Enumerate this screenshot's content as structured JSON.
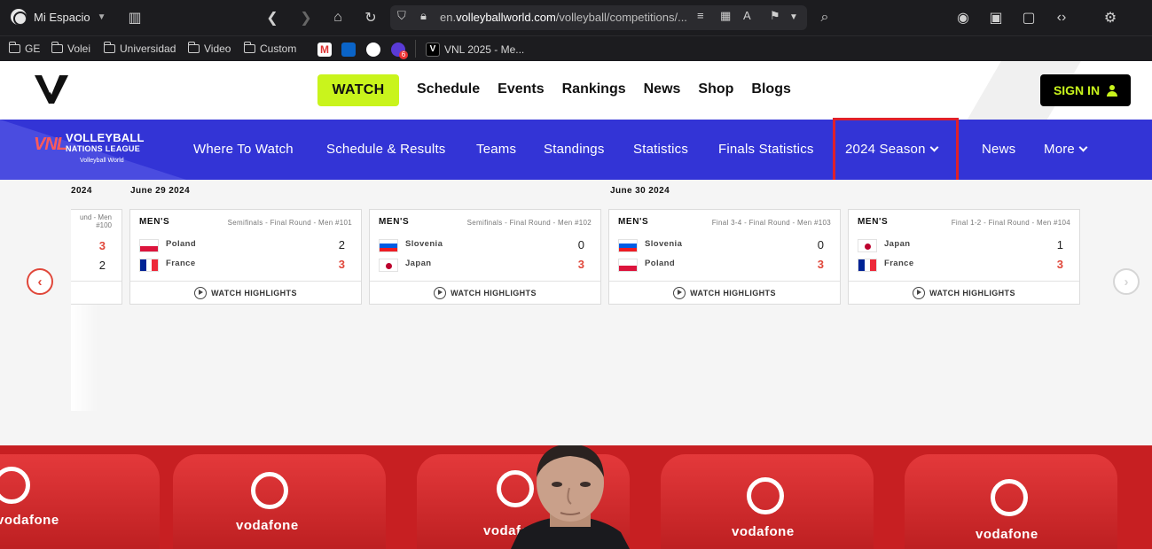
{
  "browser": {
    "profile_name": "Mi Espacio",
    "url_prefix": "en.",
    "url_domain": "volleyballworld.com",
    "url_path": "/volleyball/competitions/...",
    "bookmarks": [
      {
        "label": "GE",
        "type": "folder"
      },
      {
        "label": "Volei",
        "type": "folder"
      },
      {
        "label": "Universidad",
        "type": "folder"
      },
      {
        "label": "Video",
        "type": "folder"
      },
      {
        "label": "Custom",
        "type": "folder"
      }
    ],
    "pinned_tab_title": "VNL 2025 - Me...",
    "mail_badge": "6"
  },
  "site_header": {
    "watch_label": "WATCH",
    "nav": [
      "Schedule",
      "Events",
      "Rankings",
      "News",
      "Shop",
      "Blogs"
    ],
    "signin_label": "SIGN IN"
  },
  "vnl_nav": {
    "logo_mark": "VNL",
    "logo_line1": "VOLLEYBALL",
    "logo_line2": "NATIONS LEAGUE",
    "logo_line3": "Volleyball World",
    "links": [
      "Where To Watch",
      "Schedule & Results",
      "Teams",
      "Standings",
      "Statistics",
      "Finals Statistics",
      "2024 Season",
      "News",
      "More"
    ],
    "highlight_color": "#e0202a",
    "bar_color": "#3334d6"
  },
  "matches": {
    "dates": [
      "2024",
      "June 29 2024",
      "June 30 2024"
    ],
    "partial_card": {
      "round": "und - Men #100",
      "score_a": "3",
      "score_b": "2"
    },
    "highlights_label": "WATCH HIGHLIGHTS",
    "cards": [
      {
        "gender": "MEN'S",
        "round": "Semifinals - Final Round - Men #101",
        "team_a": {
          "name": "Poland",
          "flag": "pl",
          "score": "2"
        },
        "team_b": {
          "name": "France",
          "flag": "fr",
          "score": "3"
        }
      },
      {
        "gender": "MEN'S",
        "round": "Semifinals - Final Round - Men #102",
        "team_a": {
          "name": "Slovenia",
          "flag": "si",
          "score": "0"
        },
        "team_b": {
          "name": "Japan",
          "flag": "jp",
          "score": "3"
        }
      },
      {
        "gender": "MEN'S",
        "round": "Final 3-4 - Final Round - Men #103",
        "team_a": {
          "name": "Slovenia",
          "flag": "si",
          "score": "0"
        },
        "team_b": {
          "name": "Poland",
          "flag": "pl",
          "score": "3"
        }
      },
      {
        "gender": "MEN'S",
        "round": "Final 1-2 - Final Round - Men #104",
        "team_a": {
          "name": "Japan",
          "flag": "jp",
          "score": "1"
        },
        "team_b": {
          "name": "France",
          "flag": "fr",
          "score": "3"
        }
      }
    ],
    "win_color": "#e0473a"
  },
  "hero": {
    "sponsor_word": "vodafone"
  }
}
